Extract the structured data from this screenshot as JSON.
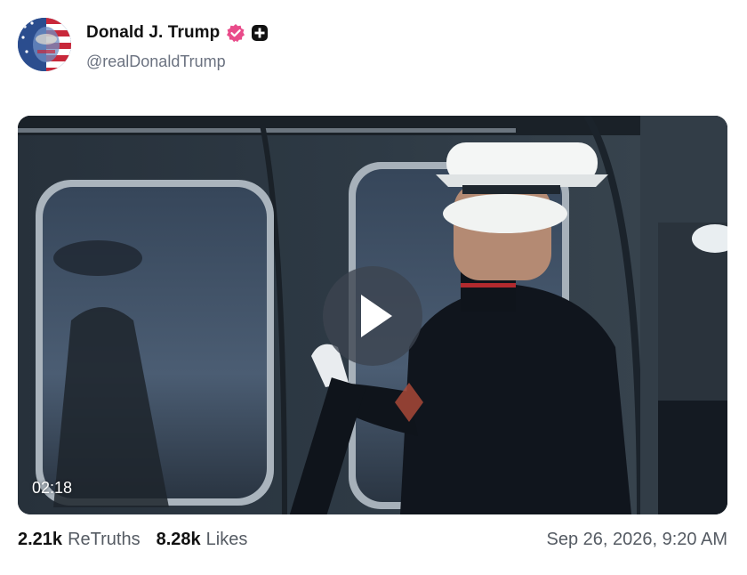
{
  "post": {
    "author_name": "Donald J. Trump",
    "author_handle": "@realDonaldTrump",
    "video": {
      "duration": "02:18"
    },
    "stats": {
      "retruths_count": "2.21k",
      "retruths_label": "ReTruths",
      "likes_count": "8.28k",
      "likes_label": "Likes"
    },
    "timestamp": "Sep 26, 2026, 9:20 AM"
  },
  "colors": {
    "verified_badge": "#e94b8a",
    "plus_badge": "#111111",
    "handle_text": "#6b7280"
  },
  "icons": {
    "verified": "verified-badge-icon",
    "plus": "plus-badge-icon",
    "play": "play-icon"
  }
}
